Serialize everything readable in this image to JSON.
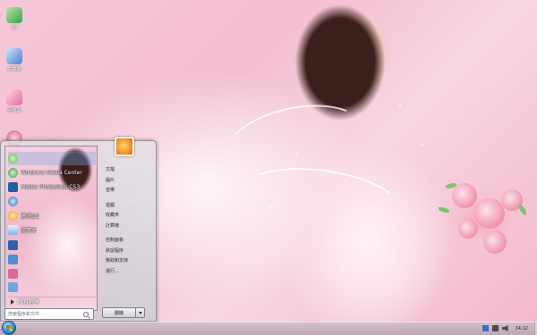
{
  "desktop": {
    "icons": [
      {
        "label": "cdr",
        "icon": "cdr-icon",
        "color": "#3aa04c"
      },
      {
        "label": "計算機",
        "icon": "computer-icon",
        "color": "#4d7fd0"
      },
      {
        "label": "回收站",
        "icon": "recycle-bin-icon",
        "color": "#e06fa0"
      },
      {
        "label": "網絡",
        "icon": "network-icon",
        "color": "#d94c78"
      }
    ]
  },
  "start_menu": {
    "programs": [
      {
        "label": "",
        "icon": "start-app-icon",
        "color": "#5dbb4a"
      },
      {
        "label": "Windows Media Center",
        "icon": "media-center-icon",
        "color": "#2f9a3a"
      },
      {
        "label": "Adobe Photoshop CS3",
        "icon": "photoshop-icon",
        "color": "#1f5fa6"
      },
      {
        "label": "",
        "icon": "ie-icon",
        "color": "#2b74c8"
      },
      {
        "label": "騰訊QQ",
        "icon": "qq-icon",
        "color": "#f0a020"
      },
      {
        "label": "記事本",
        "icon": "notepad-icon",
        "color": "#7fb5e8"
      },
      {
        "label": "",
        "icon": "word-icon",
        "color": "#2e5fa8"
      },
      {
        "label": "",
        "icon": "app-icon",
        "color": "#4f8fd8"
      },
      {
        "label": "",
        "icon": "app2-icon",
        "color": "#d86a9a"
      },
      {
        "label": "",
        "icon": "app3-icon",
        "color": "#6aa8e0"
      }
    ],
    "all_programs_label": "所有程序",
    "search_placeholder": "搜索程序和文件",
    "right_items": [
      {
        "label": "文檔"
      },
      {
        "label": "圖片"
      },
      {
        "label": "音樂"
      },
      {
        "label": "遊戲"
      },
      {
        "label": "收藏夾"
      },
      {
        "label": "計算機"
      },
      {
        "label": "控制面板"
      },
      {
        "label": "默認程序"
      },
      {
        "label": "幫助和支持"
      },
      {
        "label": "運行..."
      }
    ],
    "shutdown_label": "關機"
  },
  "taskbar": {
    "clock": "14:12",
    "tray_icons": [
      {
        "icon": "flag-icon",
        "color": "#3b6fbf"
      },
      {
        "icon": "network-tray-icon",
        "color": "#4a4a4a"
      },
      {
        "icon": "volume-icon",
        "color": "#4a4a4a"
      }
    ]
  }
}
